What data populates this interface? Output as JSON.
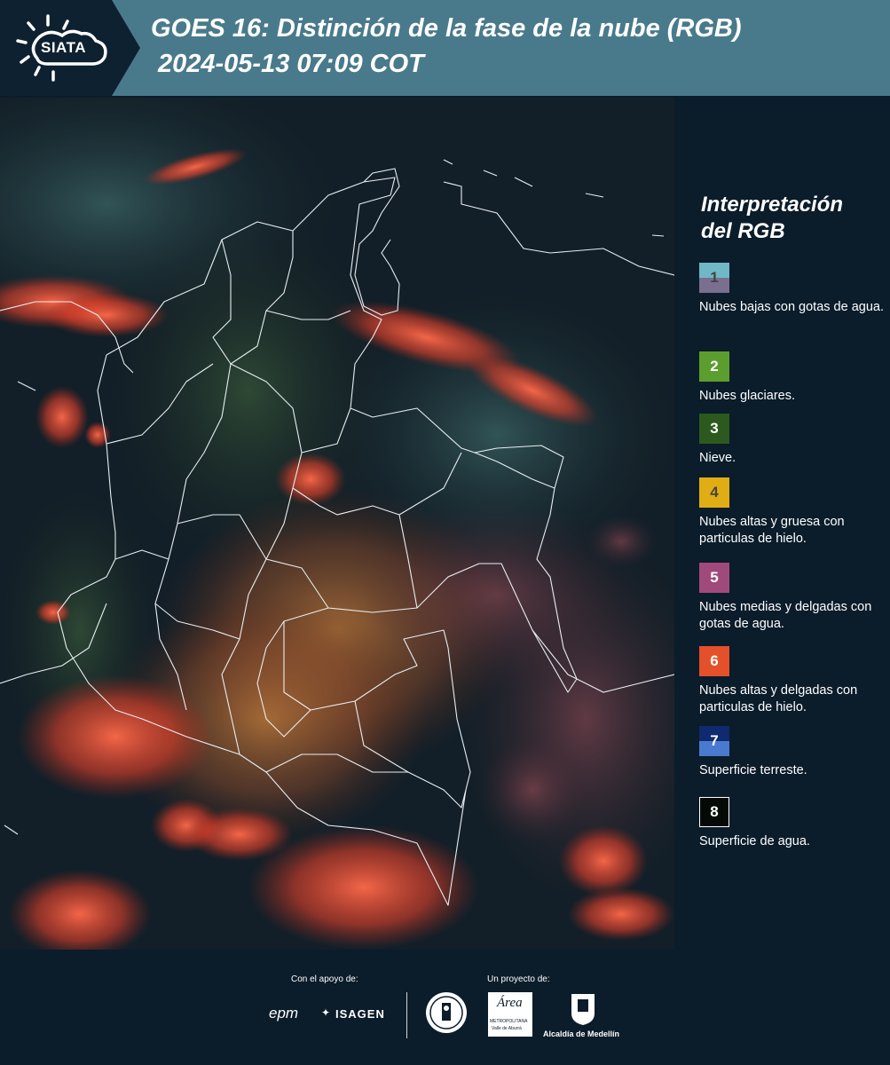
{
  "header": {
    "logo_text": "SIATA",
    "title_line1": "GOES 16: Distinción de la fase de la nube (RGB)",
    "title_line2": "2024-05-13 07:09 COT"
  },
  "legend": {
    "title_line1": "Interpretación",
    "title_line2": "del RGB",
    "items": [
      {
        "number": "1",
        "desc": "Nubes bajas con gotas de agua.",
        "color_top": "#6fb8c6",
        "color_bottom": "#7a6f8e"
      },
      {
        "number": "2",
        "desc": "Nubes glaciares.",
        "color_top": "#5c9e2e",
        "color_bottom": "#5c9e2e"
      },
      {
        "number": "3",
        "desc": "Nieve.",
        "color_top": "#2c5a1e",
        "color_bottom": "#2c5a1e"
      },
      {
        "number": "4",
        "desc": "Nubes altas y gruesa con particulas de hielo.",
        "color_top": "#e0ae14",
        "color_bottom": "#e0ae14"
      },
      {
        "number": "5",
        "desc": "Nubes medias y delgadas con gotas de agua.",
        "color_top": "#a04a7c",
        "color_bottom": "#a04a7c"
      },
      {
        "number": "6",
        "desc": "Nubes altas y delgadas con particulas de hielo.",
        "color_top": "#e4502a",
        "color_bottom": "#e4502a"
      },
      {
        "number": "7",
        "desc": "Superficie terreste.",
        "color_top": "#0f2a6e",
        "color_bottom": "#4a7ad0"
      },
      {
        "number": "8",
        "desc": "Superficie de agua.",
        "color_top": "#050a06",
        "color_bottom": "#050a06"
      }
    ]
  },
  "footer": {
    "support_label": "Con el apoyo de:",
    "project_label": "Un proyecto de:",
    "brand_epm": "epm",
    "brand_isagen": "ISAGEN",
    "brand_area": "Área",
    "brand_area_sub": "METROPOLITANA",
    "brand_area_sub2": "Valle de Aburrá",
    "brand_alcaldia": "Alcaldía de Medellín"
  }
}
